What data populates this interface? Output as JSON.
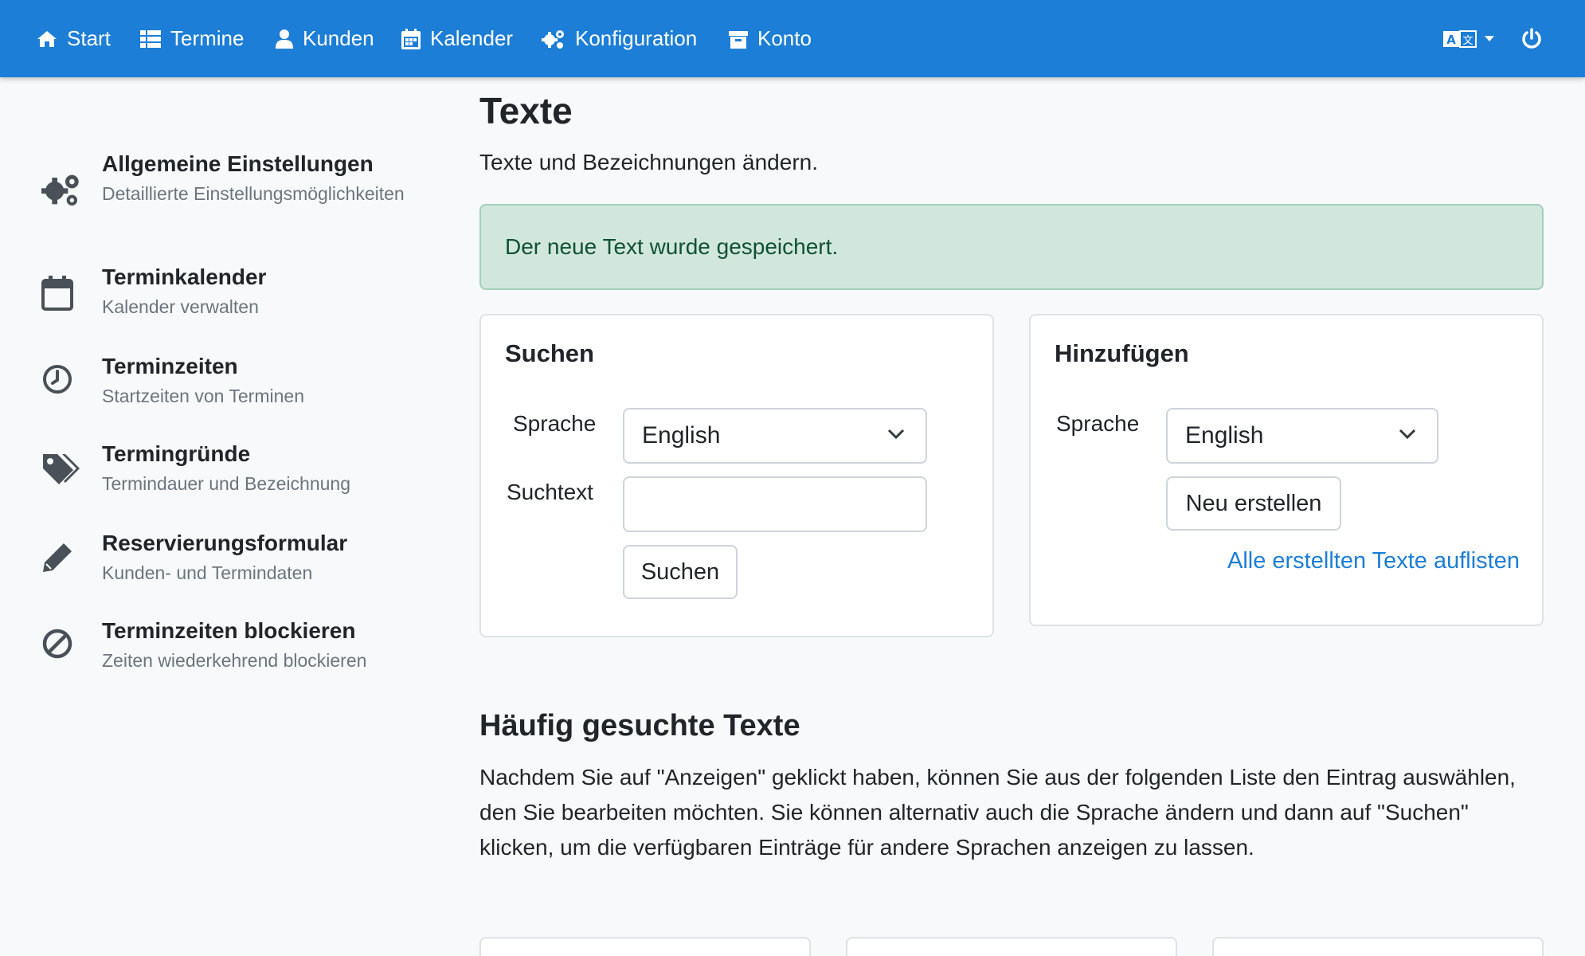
{
  "nav": {
    "items": [
      {
        "label": "Start",
        "icon": "home-icon"
      },
      {
        "label": "Termine",
        "icon": "list-icon"
      },
      {
        "label": "Kunden",
        "icon": "user-icon"
      },
      {
        "label": "Kalender",
        "icon": "calendar-icon"
      },
      {
        "label": "Konfiguration",
        "icon": "gears-icon"
      },
      {
        "label": "Konto",
        "icon": "archive-icon"
      }
    ],
    "language_icon": "language-icon",
    "logout_icon": "power-icon"
  },
  "sidebar": {
    "items": [
      {
        "title": "Allgemeine Einstellungen",
        "subtitle": "Detaillierte Einstellungsmöglichkeiten",
        "icon": "gears-icon"
      },
      {
        "title": "Terminkalender",
        "subtitle": "Kalender verwalten",
        "icon": "calendar-icon"
      },
      {
        "title": "Terminzeiten",
        "subtitle": "Startzeiten von Terminen",
        "icon": "clock-icon"
      },
      {
        "title": "Termingründe",
        "subtitle": "Termindauer und Bezeichnung",
        "icon": "tags-icon"
      },
      {
        "title": "Reservierungsformular",
        "subtitle": "Kunden- und Termindaten",
        "icon": "pencil-icon"
      },
      {
        "title": "Terminzeiten blockieren",
        "subtitle": "Zeiten wiederkehrend blockieren",
        "icon": "ban-icon"
      }
    ]
  },
  "main": {
    "title": "Texte",
    "subtitle": "Texte und Bezeichnungen ändern.",
    "alert": "Der neue Text wurde gespeichert.",
    "search_card": {
      "title": "Suchen",
      "language_label": "Sprache",
      "language_value": "English",
      "searchtext_label": "Suchtext",
      "searchtext_value": "",
      "search_button": "Suchen"
    },
    "add_card": {
      "title": "Hinzufügen",
      "language_label": "Sprache",
      "language_value": "English",
      "create_button": "Neu erstellen",
      "list_link": "Alle erstellten Texte auflisten"
    },
    "frequent": {
      "title": "Häufig gesuchte Texte",
      "text": "Nachdem Sie auf \"Anzeigen\" geklickt haben, können Sie aus der folgenden Liste den Eintrag auswählen, den Sie bearbeiten möchten. Sie können alternativ auch die Sprache ändern und dann auf \"Suchen\" klicken, um die verfügbaren Einträge für andere Sprachen anzeigen zu lassen."
    }
  },
  "colors": {
    "navbar": "#1c7ed6",
    "link": "#1c7ed6",
    "alert_bg": "#d1e7dd",
    "alert_text": "#0f5132"
  }
}
